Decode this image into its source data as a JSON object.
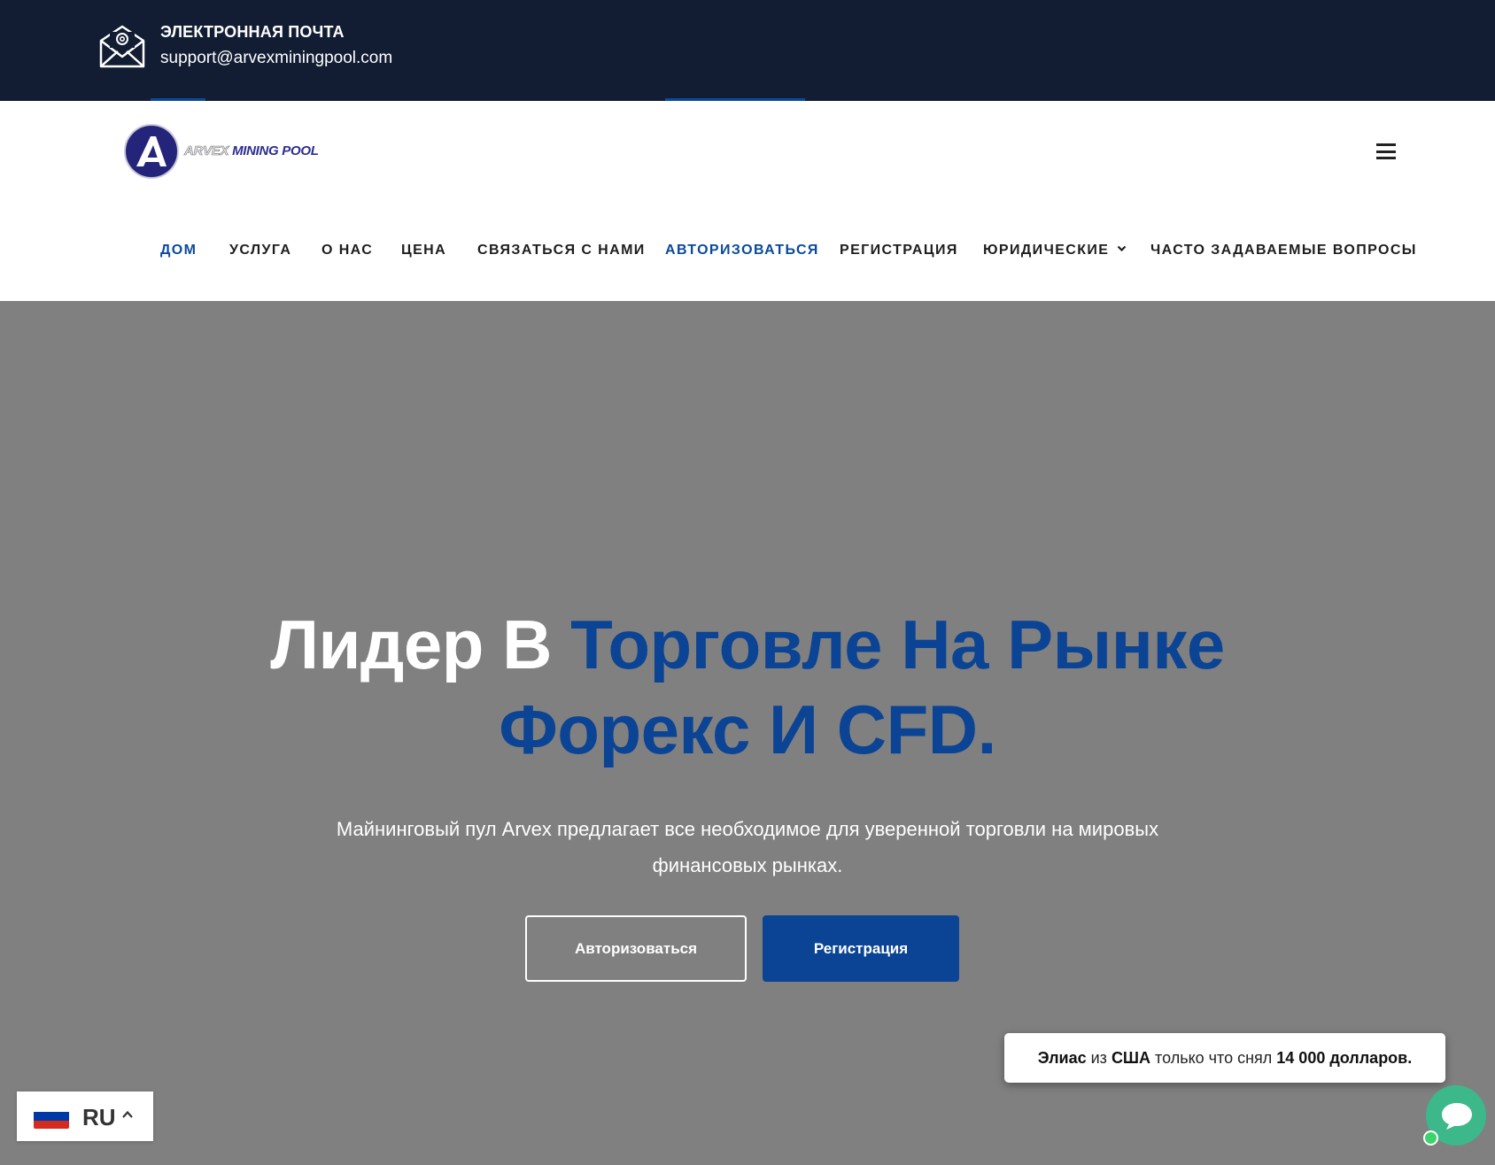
{
  "topbar": {
    "email_label": "ЭЛЕКТРОННАЯ ПОЧТА",
    "email_value": "support@arvexminingpool.com",
    "icon": "envelope-at-icon"
  },
  "header": {
    "logo_text_a": "ARVEX ",
    "logo_text_b": "MINING POOL",
    "menu_icon": "hamburger-icon"
  },
  "nav": {
    "items": [
      {
        "label": "ДОМ"
      },
      {
        "label": "УСЛУГА"
      },
      {
        "label": "О НАС"
      },
      {
        "label": "ЦЕНА"
      },
      {
        "label": "СВЯЗАТЬСЯ С НАМИ"
      },
      {
        "label": "АВТОРИЗОВАТЬСЯ"
      },
      {
        "label": "РЕГИСТРАЦИЯ"
      },
      {
        "label": "ЮРИДИЧЕСКИЕ"
      },
      {
        "label": "ЧАСТО ЗАДАВАЕМЫЕ ВОПРОСЫ"
      }
    ]
  },
  "hero": {
    "title_white": "Лидер В ",
    "title_blue_1": "Торговле На Рынке",
    "title_blue_2": "Форекс И CFD.",
    "subtitle": "Майнинговый пул Arvex предлагает все необходимое для уверенной торговли на мировых финансовых рынках.",
    "login_button": "Авторизоваться",
    "register_button": "Регистрация"
  },
  "toast": {
    "name": "Элиас",
    "from": "из",
    "country": "США",
    "action": "только что снял",
    "amount": "14 000 долларов."
  },
  "language": {
    "code": "RU",
    "flag_colors": [
      "#ffffff",
      "#0039a6",
      "#d52b1e"
    ]
  },
  "colors": {
    "topbar_bg": "#121d33",
    "accent": "#0b4494",
    "hero_bg": "#808080",
    "chat": "#3cb88a"
  }
}
